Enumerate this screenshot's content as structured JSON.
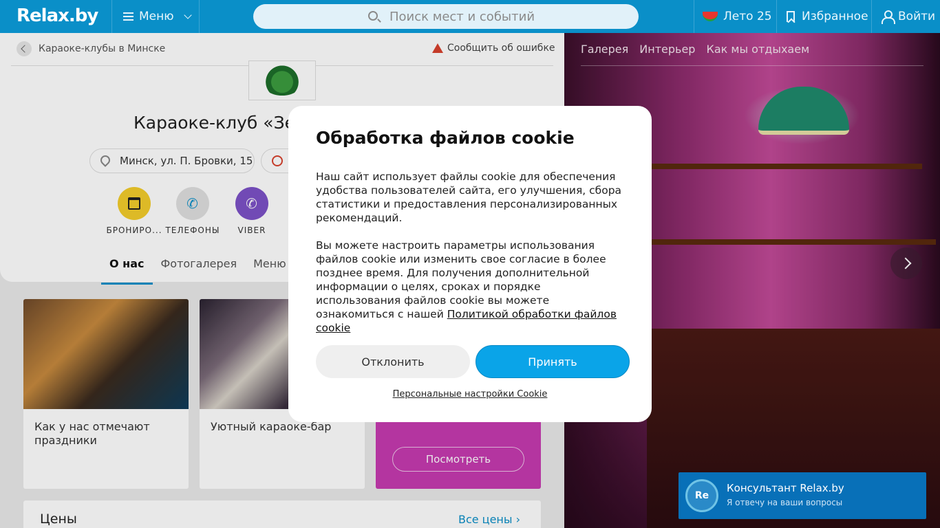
{
  "header": {
    "logo": "Relax.by",
    "menu_label": "Меню",
    "search_placeholder": "Поиск мест и событий",
    "summer_label": "Лето 25",
    "favorites_label": "Избранное",
    "login_label": "Войти"
  },
  "venue": {
    "breadcrumb": "Караоке-клубы в Минске",
    "report_error": "Сообщить об ошибке",
    "title": "Караоке-клуб «Зе",
    "address": "Минск, ул. П. Бровки, 15",
    "actions": [
      {
        "label": "БРОНИРО...",
        "icon": "calendar-check-icon"
      },
      {
        "label": "ТЕЛЕФОНЫ",
        "icon": "phone-icon"
      },
      {
        "label": "VIBER",
        "icon": "viber-icon"
      }
    ],
    "tabs": [
      "О нас",
      "Фотогалерея",
      "Меню и"
    ],
    "active_tab": "О нас"
  },
  "cards": [
    {
      "caption": "Как у нас отмечают праздники"
    },
    {
      "caption": "Уютный караоке-бар"
    },
    {
      "caption": "",
      "button": "Посмотреть"
    }
  ],
  "prices": {
    "title": "Цены",
    "all_link": "Все цены"
  },
  "gallery": {
    "tabs": [
      "Галерея",
      "Интерьер",
      "Как мы отдыхаем"
    ]
  },
  "cookie_modal": {
    "title": "Обработка файлов cookie",
    "paragraph1": "Наш сайт использует файлы cookie для обеспечения удобства пользователей сайта, его улучшения, сбора статистики и предоставления персонализированных рекомендаций.",
    "paragraph2": "Вы можете настроить параметры использования файлов cookie или изменить свое согласие в более позднее время. Для получения дополнительной информации о целях, сроках и порядке использования файлов cookie вы можете ознакомиться с нашей",
    "policy_link": "Политикой обработки файлов cookie",
    "decline": "Отклонить",
    "accept": "Принять",
    "personal_settings": "Персональные настройки Cookie"
  },
  "chat": {
    "avatar": "Re",
    "title": "Консультант Relax.by",
    "subtitle": "Я отвечу на ваши вопросы"
  },
  "colors": {
    "brand": "#0a8fc8",
    "accept": "#0aa4e8",
    "booking": "#f3cd2b",
    "viber": "#7d52c7",
    "promo_card": "#c63bb0"
  }
}
